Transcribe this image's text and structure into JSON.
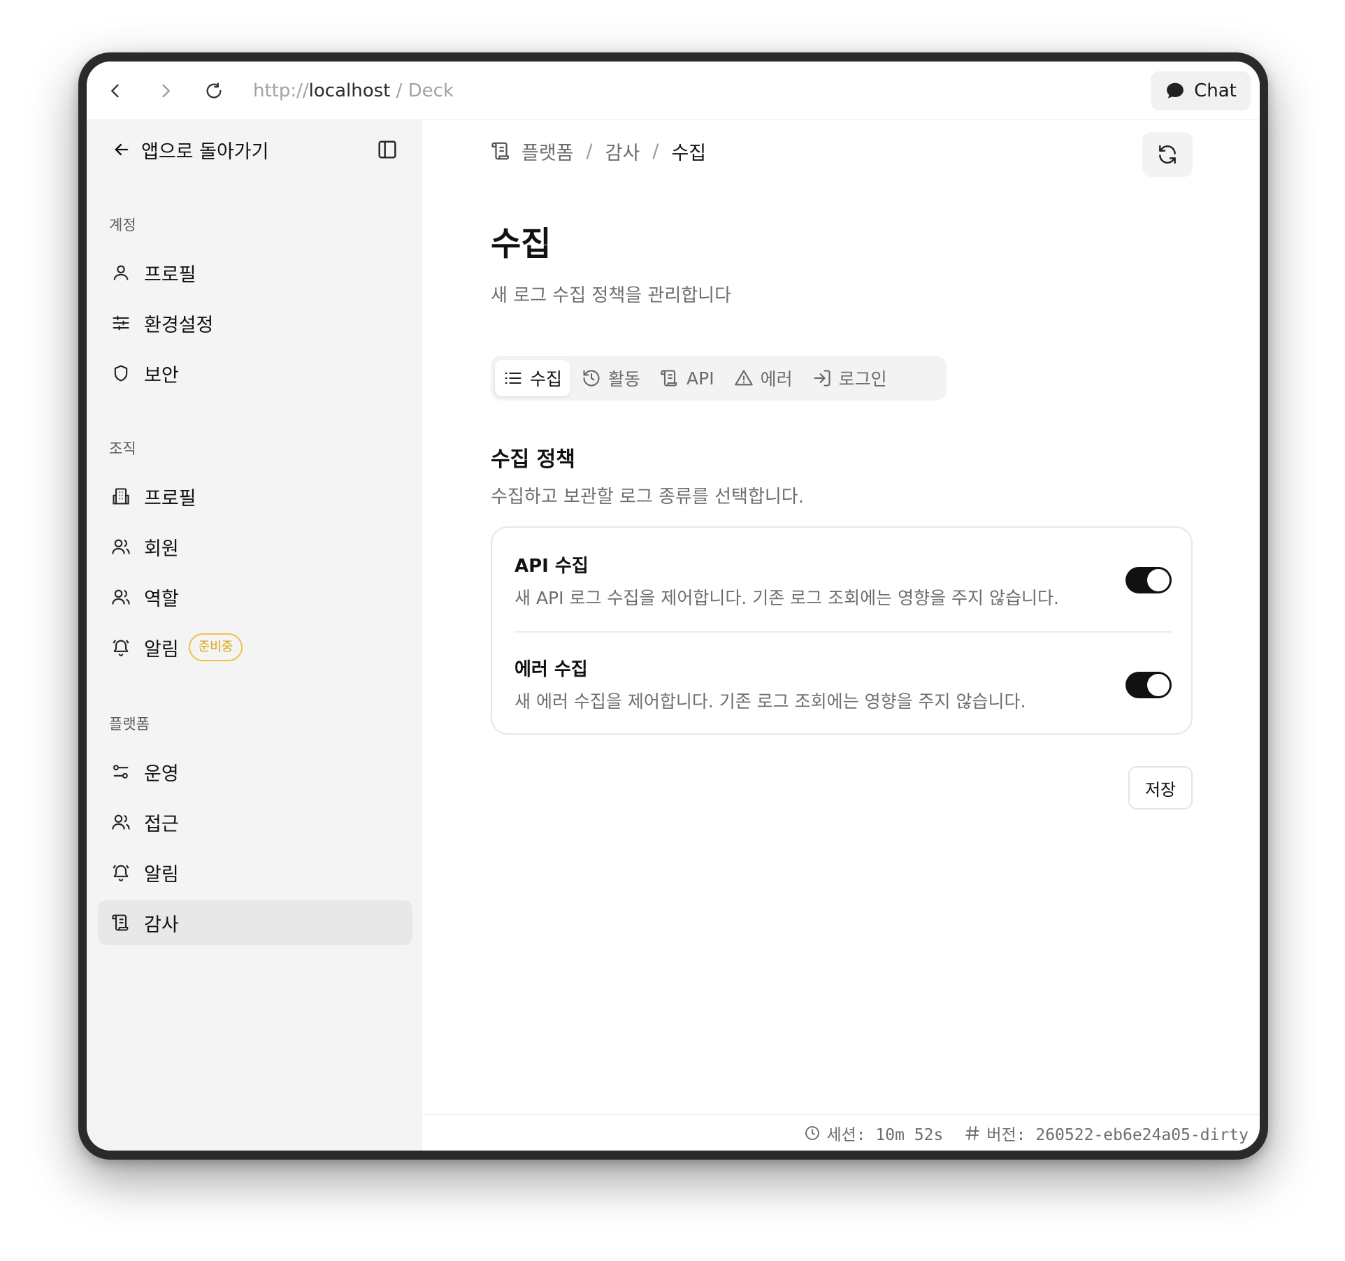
{
  "browser": {
    "url_scheme": "http://",
    "url_host": "localhost",
    "url_path": " / Deck",
    "chat_label": "Chat"
  },
  "sidebar": {
    "back_label": "앱으로 돌아가기",
    "sections": [
      {
        "label": "계정",
        "items": [
          {
            "label": "프로필",
            "icon": "user-icon"
          },
          {
            "label": "환경설정",
            "icon": "sliders-icon"
          },
          {
            "label": "보안",
            "icon": "shield-icon"
          }
        ]
      },
      {
        "label": "조직",
        "items": [
          {
            "label": "프로필",
            "icon": "building-icon"
          },
          {
            "label": "회원",
            "icon": "users-icon"
          },
          {
            "label": "역할",
            "icon": "users-icon"
          },
          {
            "label": "알림",
            "icon": "bell-icon",
            "badge": "준비중"
          }
        ]
      },
      {
        "label": "플랫폼",
        "items": [
          {
            "label": "운영",
            "icon": "toggles-icon"
          },
          {
            "label": "접근",
            "icon": "users-icon"
          },
          {
            "label": "알림",
            "icon": "bell-icon"
          },
          {
            "label": "감사",
            "icon": "scroll-icon",
            "active": true
          }
        ]
      }
    ]
  },
  "breadcrumb": {
    "items": [
      "플랫폼",
      "감사",
      "수집"
    ]
  },
  "page": {
    "title": "수집",
    "subtitle": "새 로그 수집 정책을 관리합니다"
  },
  "tabs": [
    {
      "label": "수집",
      "icon": "list-icon",
      "active": true
    },
    {
      "label": "활동",
      "icon": "history-icon"
    },
    {
      "label": "API",
      "icon": "scroll-icon"
    },
    {
      "label": "에러",
      "icon": "warning-icon"
    },
    {
      "label": "로그인",
      "icon": "login-icon"
    }
  ],
  "policy": {
    "title": "수집 정책",
    "description": "수집하고 보관할 로그 종류를 선택합니다.",
    "settings": [
      {
        "title": "API 수집",
        "description": "새 API 로그 수집을 제어합니다. 기존 로그 조회에는 영향을 주지 않습니다.",
        "enabled": true
      },
      {
        "title": "에러 수집",
        "description": "새 에러 수집을 제어합니다. 기존 로그 조회에는 영향을 주지 않습니다.",
        "enabled": true
      }
    ],
    "save_label": "저장"
  },
  "footer": {
    "session": "세션: 10m 52s",
    "version": "버전: 260522-eb6e24a05-dirty"
  },
  "colors": {
    "accent": "#111111",
    "badge": "#e2a415",
    "sidebar_bg": "#f4f4f4"
  }
}
